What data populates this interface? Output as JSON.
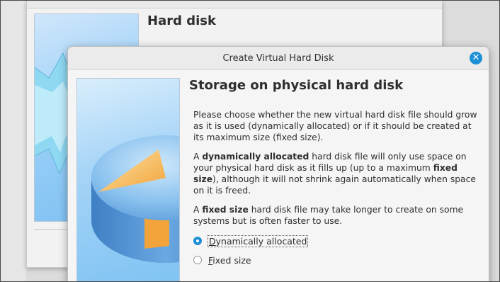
{
  "background_window": {
    "title": "Hard disk"
  },
  "dialog": {
    "title": "Create Virtual Hard Disk",
    "heading": "Storage on physical hard disk",
    "paragraph1": "Please choose whether the new virtual hard disk file should grow as it is used (dynamically allocated) or if it should be created at its maximum size (fixed size).",
    "paragraph2": {
      "t1": "A ",
      "b1": "dynamically allocated",
      "t2": " hard disk file will only use space on your physical hard disk as it fills up (up to a maximum ",
      "b2": "fixed size",
      "t3": "), although it will not shrink again automatically when space on it is freed."
    },
    "paragraph3": {
      "t1": "A ",
      "b1": "fixed size",
      "t2": " hard disk file may take longer to create on some systems but is often faster to use."
    },
    "options": [
      {
        "mnemonic": "D",
        "rest": "ynamically allocated",
        "selected": true
      },
      {
        "mnemonic": "F",
        "rest": "ixed size",
        "selected": false
      }
    ]
  },
  "colors": {
    "accent": "#1e8fd5",
    "pie_top": "#6fb0e8",
    "pie_slice": "#f2a33a"
  },
  "icons": {
    "close": "close-icon",
    "radio_checked": "radio-checked-icon",
    "radio_unchecked": "radio-unchecked-icon"
  }
}
